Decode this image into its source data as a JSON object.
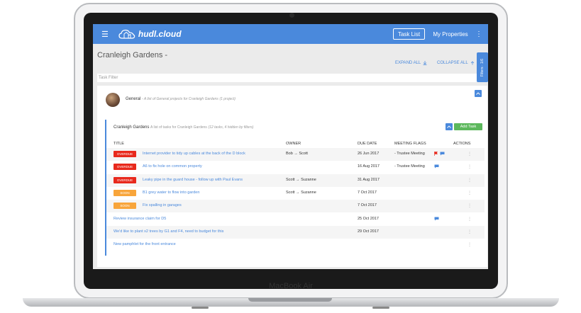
{
  "device": {
    "model_label": "MacBook Air"
  },
  "navbar": {
    "brand": "hudl.cloud",
    "task_list_label": "Task List",
    "my_properties_label": "My Properties",
    "kebab": "⋮",
    "menu_icon": "☰"
  },
  "page": {
    "title": "Cranleigh Gardens -",
    "expand_all_label": "EXPAND ALL",
    "collapse_all_label": "COLLAPSE ALL",
    "filters_tab_label": "Filters · 1/6",
    "task_filter_placeholder": "Task Filter"
  },
  "group": {
    "name": "General",
    "description": "- A list of General projects for Cranleigh Gardens",
    "count_note": "(1 project)"
  },
  "project": {
    "name": "Cranleigh Gardens",
    "description": "A list of tasks for Cranleigh Gardens",
    "count_note": "(12 tasks, 4 hidden by filters)",
    "add_task_label": "Add Task",
    "columns": {
      "title": "TITLE",
      "owner": "OWNER",
      "due_date": "DUE DATE",
      "meeting_flags": "MEETING FLAGS",
      "actions": "ACTIONS"
    },
    "rows": [
      {
        "badge": "OVERDUE",
        "title": "Internet provider to tidy up cables at the back of the D block",
        "owner": "Bob → Scott",
        "due": "26 Jun 2017",
        "meeting": "- Trustee Meeting"
      },
      {
        "badge": "OVERDUE",
        "title": "A6 to fix hole on common property",
        "owner": "",
        "due": "16 Aug 2017",
        "meeting": "- Trustee Meeting"
      },
      {
        "badge": "OVERDUE",
        "title": "Leaky pipe in the guard house - follow up with Paul Evans",
        "owner": "Scott → Suzanne",
        "due": "31 Aug 2017",
        "meeting": ""
      },
      {
        "badge": "SOON",
        "title": "B1 grey water to flow into garden",
        "owner": "Scott → Suzanne",
        "due": "7 Oct 2017",
        "meeting": ""
      },
      {
        "badge": "SOON",
        "title": "Fix spalling in garages",
        "owner": "",
        "due": "7 Oct 2017",
        "meeting": ""
      },
      {
        "badge": "",
        "title": "Review insurance claim for D5",
        "owner": "",
        "due": "25 Oct 2017",
        "meeting": ""
      },
      {
        "badge": "",
        "title": "We'd like to plant x2 trees by G1 and F4, need to budget for this",
        "owner": "",
        "due": "29 Oct 2017",
        "meeting": ""
      },
      {
        "badge": "",
        "title": "New pamphlet for the front entrance",
        "owner": "",
        "due": "",
        "meeting": ""
      }
    ]
  },
  "colors": {
    "brand_blue": "#4a89dc",
    "overdue_red": "#e8291c",
    "soon_orange": "#f8a53b",
    "add_green": "#5cb85c"
  }
}
